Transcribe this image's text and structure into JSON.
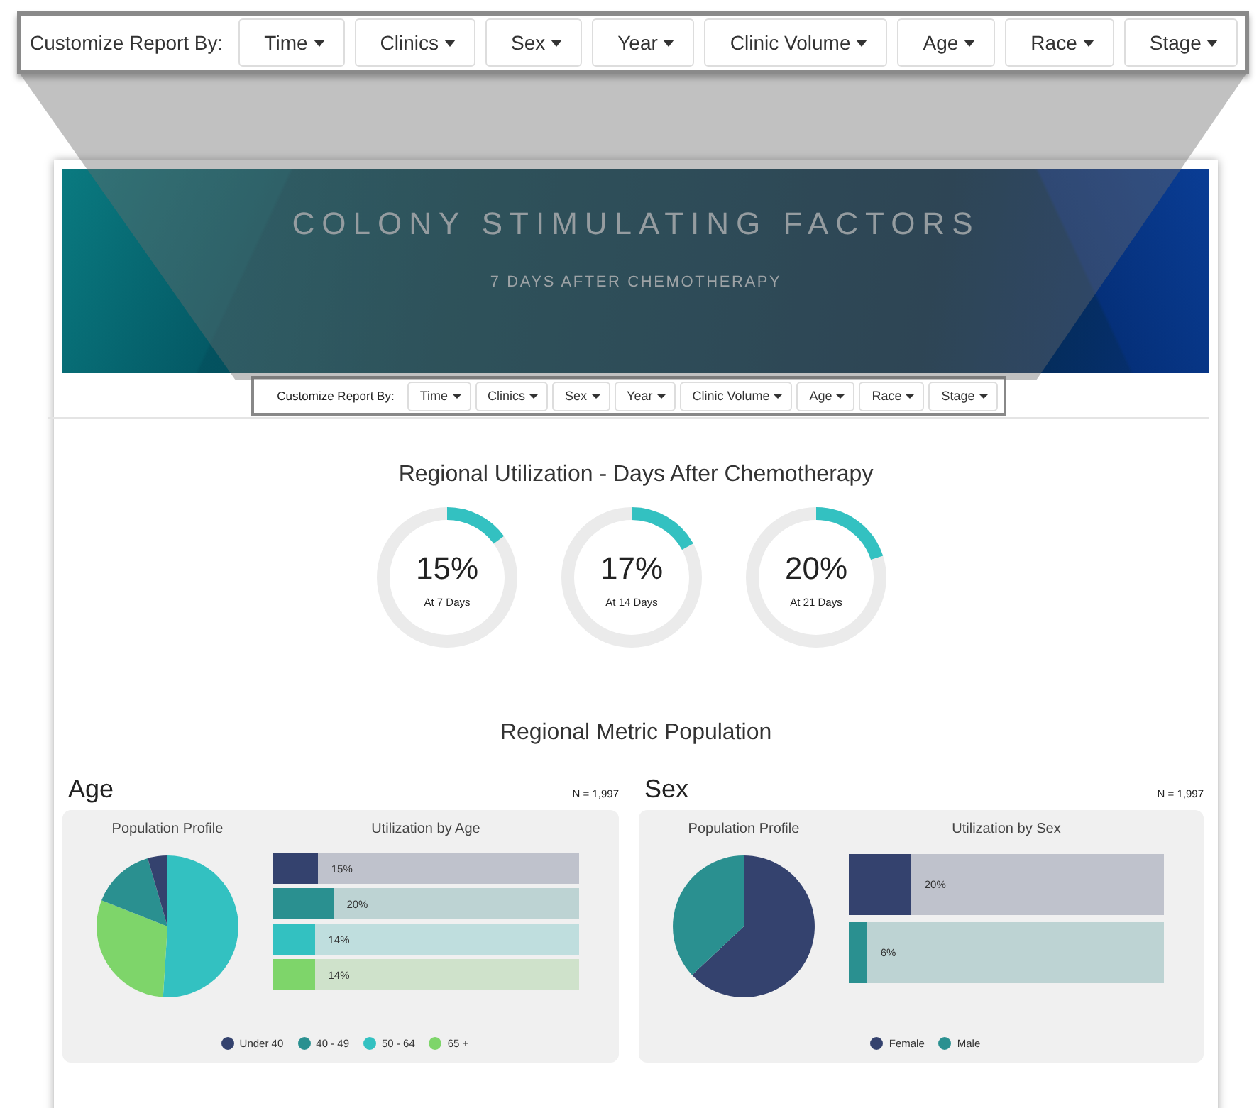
{
  "toolbar": {
    "label": "Customize Report By:",
    "buttons": [
      "Time",
      "Clinics",
      "Sex",
      "Year",
      "Clinic Volume",
      "Age",
      "Race",
      "Stage"
    ]
  },
  "banner": {
    "title": "COLONY STIMULATING FACTORS",
    "subtitle": "7 DAYS AFTER CHEMOTHERAPY"
  },
  "report_toolbar": {
    "label": "Customize Report By:",
    "buttons": [
      "Time",
      "Clinics",
      "Sex",
      "Year",
      "Clinic Volume",
      "Age",
      "Race",
      "Stage"
    ]
  },
  "utilization": {
    "title": "Regional Utilization - Days After Chemotherapy",
    "gauges": [
      {
        "value": "15%",
        "label": "At 7 Days",
        "level": 0.15
      },
      {
        "value": "17%",
        "label": "At 14 Days",
        "level": 0.17
      },
      {
        "value": "20%",
        "label": "At 21 Days",
        "level": 0.2
      }
    ]
  },
  "population": {
    "title": "Regional Metric Population",
    "panels": [
      {
        "title": "Age",
        "n": "N = 1,997",
        "profile_title": "Population Profile",
        "bars_title": "Utilization by Age",
        "groups": [
          {
            "name": "Under 40",
            "color": "#34426e",
            "reading": "15%",
            "level": 0.15
          },
          {
            "name": "40 - 49",
            "color": "#2a9090",
            "reading": "20%",
            "level": 0.2
          },
          {
            "name": "50 - 64",
            "color": "#33c1c1",
            "reading": "14%",
            "level": 0.14
          },
          {
            "name": "65 +",
            "color": "#7ed56a",
            "reading": "14%",
            "level": 0.14
          }
        ]
      },
      {
        "title": "Sex",
        "n": "N = 1,997",
        "profile_title": "Population Profile",
        "bars_title": "Utilization by Sex",
        "groups": [
          {
            "name": "Female",
            "color": "#34426e",
            "reading": "20%",
            "level": 0.2
          },
          {
            "name": "Male",
            "color": "#2a9090",
            "reading": "6%",
            "level": 0.06
          }
        ]
      }
    ]
  }
}
